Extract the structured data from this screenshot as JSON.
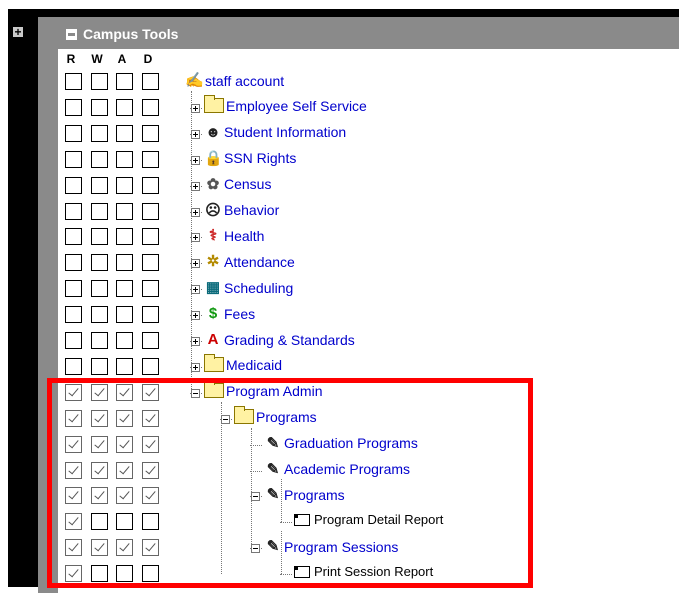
{
  "panel": {
    "title": "Campus Tools",
    "columns": [
      "R",
      "W",
      "A",
      "D"
    ]
  },
  "rows": [
    {
      "label": "staff account",
      "icon": "staff-account-icon",
      "level": 0,
      "expander": "none",
      "checks": [
        false,
        false,
        false,
        false
      ]
    },
    {
      "label": "Employee Self Service",
      "icon": "folder-icon",
      "level": 1,
      "expander": "plus",
      "checks": [
        false,
        false,
        false,
        false
      ]
    },
    {
      "label": "Student Information",
      "icon": "student-icon",
      "level": 1,
      "expander": "plus",
      "checks": [
        false,
        false,
        false,
        false
      ]
    },
    {
      "label": "SSN Rights",
      "icon": "lock-icon",
      "level": 1,
      "expander": "plus",
      "checks": [
        false,
        false,
        false,
        false
      ]
    },
    {
      "label": "Census",
      "icon": "census-icon",
      "level": 1,
      "expander": "plus",
      "checks": [
        false,
        false,
        false,
        false
      ]
    },
    {
      "label": "Behavior",
      "icon": "behavior-icon",
      "level": 1,
      "expander": "plus",
      "checks": [
        false,
        false,
        false,
        false
      ]
    },
    {
      "label": "Health",
      "icon": "health-icon",
      "level": 1,
      "expander": "plus",
      "checks": [
        false,
        false,
        false,
        false
      ]
    },
    {
      "label": "Attendance",
      "icon": "attendance-icon",
      "level": 1,
      "expander": "plus",
      "checks": [
        false,
        false,
        false,
        false
      ]
    },
    {
      "label": "Scheduling",
      "icon": "scheduling-icon",
      "level": 1,
      "expander": "plus",
      "checks": [
        false,
        false,
        false,
        false
      ]
    },
    {
      "label": "Fees",
      "icon": "dollar-icon",
      "level": 1,
      "expander": "plus",
      "checks": [
        false,
        false,
        false,
        false
      ]
    },
    {
      "label": "Grading & Standards",
      "icon": "grade-icon",
      "level": 1,
      "expander": "plus",
      "checks": [
        false,
        false,
        false,
        false
      ]
    },
    {
      "label": "Medicaid",
      "icon": "folder-icon",
      "level": 1,
      "expander": "plus",
      "checks": [
        false,
        false,
        false,
        false
      ]
    },
    {
      "label": "Program Admin",
      "icon": "folder-icon",
      "level": 1,
      "expander": "minus",
      "checks": [
        true,
        true,
        true,
        true
      ]
    },
    {
      "label": "Programs",
      "icon": "folder-icon",
      "level": 2,
      "expander": "minus",
      "checks": [
        true,
        true,
        true,
        true
      ]
    },
    {
      "label": "Graduation Programs",
      "icon": "edit-page-icon",
      "level": 3,
      "expander": "none",
      "checks": [
        true,
        true,
        true,
        true
      ]
    },
    {
      "label": "Academic Programs",
      "icon": "edit-page-icon",
      "level": 3,
      "expander": "none",
      "checks": [
        true,
        true,
        true,
        true
      ]
    },
    {
      "label": "Programs",
      "icon": "edit-page-icon",
      "level": 3,
      "expander": "minus",
      "checks": [
        true,
        true,
        true,
        true
      ]
    },
    {
      "label": "Program Detail Report",
      "icon": "report-icon",
      "level": 4,
      "expander": "none",
      "checks": [
        true,
        false,
        false,
        false
      ]
    },
    {
      "label": "Program Sessions",
      "icon": "edit-page-icon",
      "level": 3,
      "expander": "minus",
      "checks": [
        true,
        true,
        true,
        true
      ]
    },
    {
      "label": "Print Session Report",
      "icon": "report-icon",
      "level": 4,
      "expander": "none",
      "checks": [
        true,
        false,
        false,
        false
      ]
    }
  ],
  "colors": {
    "header": "#8a8a8a",
    "link": "#0000cc",
    "highlight": "#ff0000"
  }
}
